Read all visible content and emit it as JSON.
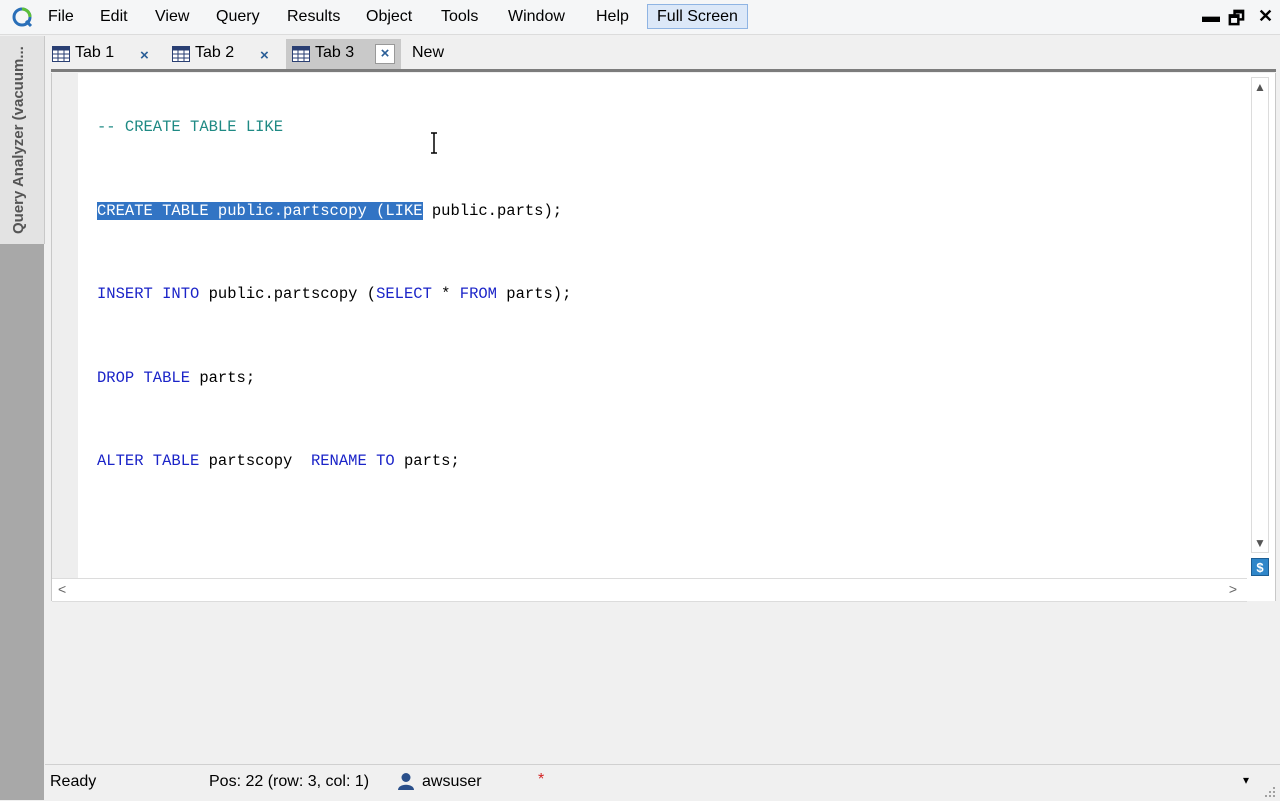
{
  "menubar": {
    "items": [
      "File",
      "Edit",
      "View",
      "Query",
      "Results",
      "Object",
      "Tools",
      "Window",
      "Help"
    ],
    "full_screen_label": "Full Screen",
    "minimize": "▬",
    "restore": "🗗",
    "close": "✕"
  },
  "sidepanel": {
    "label": "Query Analyzer (vacuum..."
  },
  "tabs": [
    {
      "label": "Tab 1",
      "close": "×"
    },
    {
      "label": "Tab 2",
      "close": "×"
    },
    {
      "label": "Tab 3",
      "close": "×"
    }
  ],
  "new_tab_label": "New",
  "editor": {
    "lines": {
      "l1": "-- CREATE TABLE LIKE",
      "l2_sel": "CREATE TABLE public.partscopy (LIKE",
      "l2_rest": " public.parts);",
      "l3_kw1": "INSERT INTO",
      "l3_t1": " public.partscopy (",
      "l3_kw2": "SELECT",
      "l3_t2": " * ",
      "l3_kw3": "FROM",
      "l3_t3": " parts);",
      "l4_kw": "DROP TABLE",
      "l4_t": " parts;",
      "l5_kw1": "ALTER TABLE",
      "l5_t1": " partscopy  ",
      "l5_kw2": "RENAME TO",
      "l5_t2": " parts;"
    },
    "scroll_up": "▲",
    "scroll_down": "▼",
    "scroll_left": "<",
    "scroll_right": ">",
    "dollar": "$"
  },
  "colors": {
    "comment": "#1f8a84",
    "keyword": "#1b24c8",
    "selection": "#3274c4"
  },
  "statusbar": {
    "status": "Ready",
    "position": "Pos: 22 (row: 3, col: 1)",
    "user": "awsuser",
    "modified": "*",
    "dropdown": "▾"
  }
}
